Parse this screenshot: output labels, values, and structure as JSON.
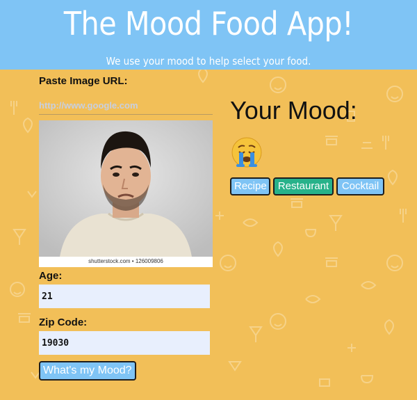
{
  "header": {
    "title": "The Mood Food App!",
    "subtitle": "We use your mood to help select your food."
  },
  "form": {
    "image_url_label": "Paste Image URL:",
    "image_url_placeholder": "http://www.google.com",
    "photo_caption": "shutterstock.com • 126009806",
    "age_label": "Age:",
    "age_value": "21",
    "zip_label": "Zip Code:",
    "zip_value": "19030",
    "submit_label": "What's my Mood?"
  },
  "mood": {
    "title": "Your Mood:",
    "emoji_icon": "crying-face-icon",
    "buttons": [
      "Recipe",
      "Restaurant",
      "Cocktail"
    ]
  },
  "colors": {
    "background": "#f2bf58",
    "header": "#7fc4f5",
    "button": "#7fc4f5",
    "button_active": "#27b28a"
  }
}
